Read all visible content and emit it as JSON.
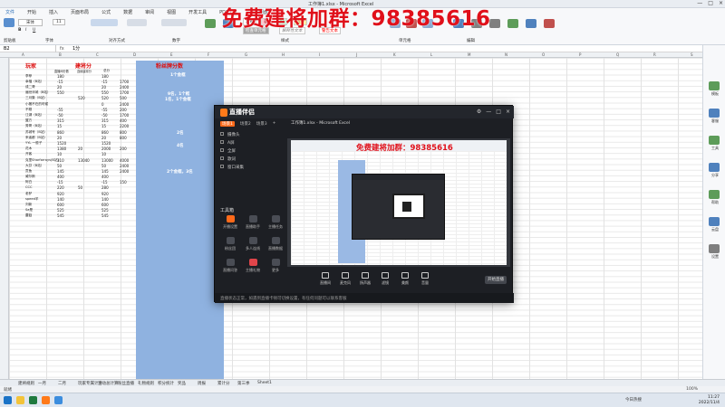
{
  "window": {
    "title": "工作簿1.xlsx - Microsoft Excel",
    "controls": [
      "—",
      "□",
      "×"
    ]
  },
  "menu": [
    "文件",
    "开始",
    "插入",
    "页面布局",
    "公式",
    "数据",
    "审阅",
    "视图",
    "开发工具",
    "PDF工具",
    "百度网盘"
  ],
  "ribbon": {
    "font_name": "宋体",
    "font_size": "11",
    "styles": [
      "常规",
      "差",
      "好",
      "适中",
      "检查单元格",
      "解释性文本",
      "警告文本"
    ],
    "groups": [
      "剪贴板",
      "字体",
      "对齐方式",
      "数字",
      "样式",
      "单元格",
      "编辑"
    ]
  },
  "formula_bar": {
    "name_box": "B2",
    "fx": "fx",
    "value": "1分"
  },
  "overlay_banner": "免费建将加群：98385616",
  "sheet": {
    "col_headers": [
      "A",
      "B",
      "C",
      "D",
      "E",
      "F",
      "G",
      "H",
      "I",
      "J",
      "K",
      "L",
      "M",
      "N",
      "O",
      "P",
      "Q",
      "R",
      "S"
    ],
    "header_left": "玩家",
    "header_mid": "建将分",
    "header_right": "粉丝牌分数",
    "subheaders": [
      "直播间分数",
      "连续建将分",
      "总分"
    ],
    "rows": [
      [
        "李菲",
        "180",
        "",
        "180"
      ],
      [
        "幸福（B站）",
        "-15",
        "",
        "-15",
        "1700"
      ],
      [
        "成二哥",
        "20",
        "",
        "20",
        "2400"
      ],
      [
        "遍世浮城（B站）",
        "550",
        "",
        "550",
        "1700"
      ],
      [
        "三月集（B站）",
        "",
        "520",
        "520",
        "500"
      ],
      [
        "小猪不在的时候",
        "",
        "",
        "0",
        "2400"
      ],
      [
        "不刚",
        "-55",
        "",
        "-55",
        "200"
      ],
      [
        "江湖（B站）",
        "-50",
        "",
        "-50",
        "1700"
      ],
      [
        "翼方",
        "315",
        "",
        "315",
        "400"
      ],
      [
        "秀哥（B站）",
        "15",
        "",
        "15",
        "2200"
      ],
      [
        "苏城号（B站）",
        "860",
        "",
        "860",
        "800"
      ],
      [
        "来者都（B站）",
        "20",
        "",
        "20",
        "800"
      ],
      [
        "YYL 一般子",
        "1520",
        "",
        "1520",
        ""
      ],
      [
        "花木",
        "1380",
        "20",
        "2000",
        "200"
      ],
      [
        "开客",
        "10",
        "",
        "10",
        ""
      ],
      [
        "克里Sharfarrays(B站)",
        "310",
        "13040",
        "13000",
        "4000"
      ],
      [
        "大芬（B站）",
        "50",
        "",
        "50",
        "2400"
      ],
      [
        "贡鱼",
        "145",
        "",
        "145",
        "2400"
      ],
      [
        "威尔斯",
        "400",
        "",
        "400",
        ""
      ],
      [
        "阿白",
        "-15",
        "",
        "-15",
        "150"
      ],
      [
        "CCC",
        "220",
        "50",
        "280",
        ""
      ],
      [
        "老驴",
        "920",
        "",
        "920",
        ""
      ],
      [
        "speed羊",
        "140",
        "",
        "140",
        ""
      ],
      [
        "刘新",
        "600",
        "",
        "600",
        ""
      ],
      [
        "Sa是",
        "525",
        "",
        "525",
        ""
      ],
      [
        "蘑菇",
        "545",
        "",
        "545",
        ""
      ]
    ],
    "blue_labels": [
      "1个金框",
      "9名，1个框",
      "1名，1个金框",
      "2名",
      "4名",
      "2个金框，3名"
    ]
  },
  "sheet_tabs": [
    "建将规则",
    "一月",
    "二月",
    "玩家专属计分",
    "活动总计算",
    "粉丝直播",
    "礼物规则",
    "积分统计",
    "奖品",
    "周报",
    "累计分",
    "第三季",
    "Sheet1"
  ],
  "status": {
    "left": "就绪",
    "zoom": "100%"
  },
  "side_panel": [
    "模板",
    "客服",
    "工具",
    "分享",
    "帮助",
    "云盘",
    "设置"
  ],
  "taskbar": {
    "weather": "今日热搜",
    "time": "11:27",
    "date": "2022/11/4"
  },
  "streaming_app": {
    "brand": "直播伴侣",
    "scene_tabs": [
      "场景1",
      "场景2",
      "场景3",
      "+"
    ],
    "sources": [
      "摄像头",
      "A屏",
      "全屏",
      "歌词",
      "窗口采集"
    ],
    "tools_title": "工具箱",
    "tools": [
      "开播设置",
      "直播助手",
      "主播任务",
      "粉丝团",
      "多人连线",
      "直播数据",
      "直播问答",
      "主播礼物",
      "更多"
    ],
    "preview_title": "工作簿1.xlsx - Microsoft Excel",
    "preview_banner": "免费建将加群：98385616",
    "bottom_controls": [
      "直播间",
      "麦克风",
      "扬声器",
      "滤镜",
      "美颜",
      "音量"
    ],
    "go_live": "开始直播",
    "status_text": "直播状态正常，如遇到直播卡顿可切换设置，有任何问题可以联系客服"
  }
}
